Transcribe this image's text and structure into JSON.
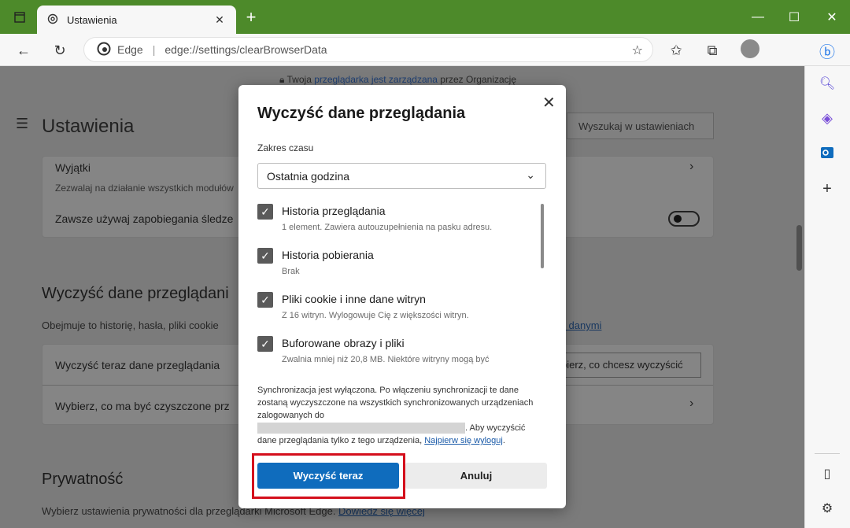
{
  "tab": {
    "title": "Ustawienia",
    "close": "✕"
  },
  "window": {
    "minimize": "—",
    "maximize": "☐",
    "close": "✕"
  },
  "omnibox": {
    "site": "Edge",
    "separator": "|",
    "url": "edge://settings/clearBrowserData"
  },
  "page": {
    "managed_prefix": "Twoja ",
    "managed_link": "przeglądarka jest zarządzana",
    "managed_suffix": " przez Organizację",
    "title": "Ustawienia",
    "search_placeholder": "Wyszukaj w ustawieniach",
    "exceptions_title": "Wyjątki",
    "exceptions_sub": "Zezwalaj na działanie wszystkich modułów",
    "always_tracking": "Zawsze używaj zapobiegania śledze",
    "clear_section_title": "Wyczyść dane przeglądani",
    "clear_section_desc": "Obejmuje to historię, hasła, pliki cookie",
    "clear_section_link": "i danymi",
    "clear_now_row": "Wyczyść teraz dane przeglądania",
    "clear_now_button_partial": "bierz, co chcesz wyczyścić",
    "choose_row": "Wybierz, co ma być czyszczone prz",
    "privacy_title": "Prywatność",
    "privacy_desc": "Wybierz ustawienia prywatności dla przeglądarki Microsoft Edge. ",
    "privacy_link": "Dowiedz się więcej"
  },
  "dialog": {
    "title": "Wyczyść dane przeglądania",
    "close": "✕",
    "range_label": "Zakres czasu",
    "range_value": "Ostatnia godzina",
    "options": [
      {
        "title": "Historia przeglądania",
        "desc": "1 element. Zawiera autouzupełnienia na pasku adresu.",
        "checked": true
      },
      {
        "title": "Historia pobierania",
        "desc": "Brak",
        "checked": true
      },
      {
        "title": "Pliki cookie i inne dane witryn",
        "desc": "Z 16 witryn. Wylogowuje Cię z większości witryn.",
        "checked": true
      },
      {
        "title": "Buforowane obrazy i pliki",
        "desc": "Zwalnia mniej niż 20,8 MB. Niektóre witryny mogą być",
        "checked": true
      }
    ],
    "sync_text": "Synchronizacja jest wyłączona. Po włączeniu synchronizacji te dane zostaną wyczyszczone na wszystkich synchronizowanych urządzeniach zalogowanych do",
    "sync_text2": ". Aby wyczyścić dane przeglądania tylko z tego urządzenia, ",
    "sync_link": "Najpierw się wyloguj",
    "sync_end": ".",
    "primary_button": "Wyczyść teraz",
    "secondary_button": "Anuluj"
  },
  "colors": {
    "accent": "#0f6cbd",
    "titlebar": "#4d8a2a",
    "highlight": "#d40f1c"
  }
}
